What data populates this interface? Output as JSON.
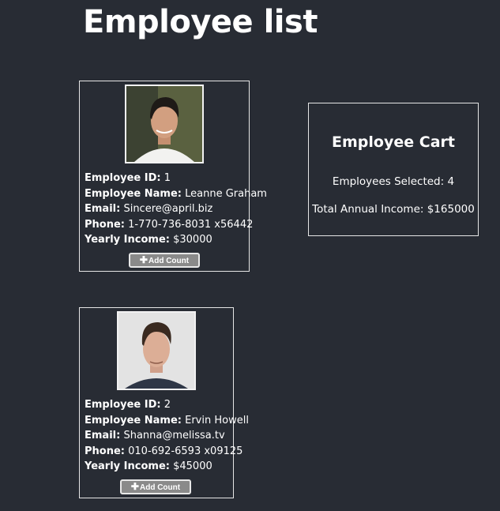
{
  "page": {
    "title": "Employee list"
  },
  "labels": {
    "id": "Employee ID:",
    "name": "Employee Name:",
    "email": "Email:",
    "phone": "Phone:",
    "income": "Yearly Income:"
  },
  "employees": [
    {
      "id": "1",
      "name": "Leanne Graham",
      "email": "Sincere@april.biz",
      "phone": "1-770-736-8031 x56442",
      "income": "$30000",
      "button_label": "Add Count"
    },
    {
      "id": "2",
      "name": "Ervin Howell",
      "email": "Shanna@melissa.tv",
      "phone": "010-692-6593 x09125",
      "income": "$45000",
      "button_label": "Add Count"
    }
  ],
  "cart": {
    "title": "Employee Cart",
    "selected_text": "Employees Selected: 4",
    "income_text": "Total Annual Income: $165000"
  },
  "icons": {
    "add": "plus-icon"
  },
  "colors": {
    "background": "#282c34",
    "button": "#8a8a8a",
    "border": "#e6e6e6"
  }
}
